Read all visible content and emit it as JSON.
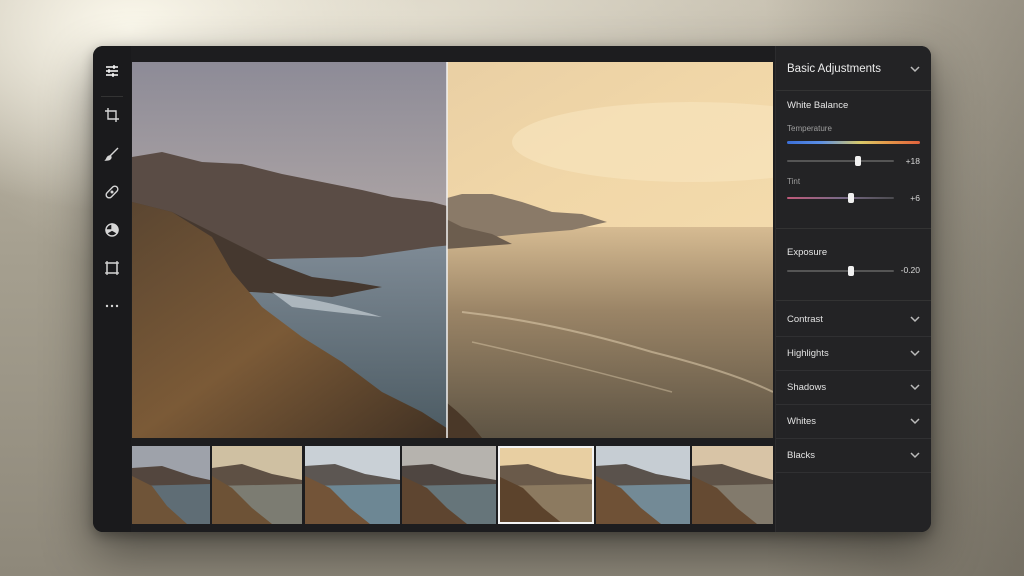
{
  "panel": {
    "title": "Basic Adjustments",
    "white_balance": {
      "title": "White Balance",
      "temperature": {
        "label": "Temperature",
        "value": "+18",
        "position": 0.66
      },
      "tint": {
        "label": "Tint",
        "value": "+6",
        "position": 0.6
      }
    },
    "exposure": {
      "title": "Exposure",
      "value": "-0.20",
      "position": 0.6
    },
    "rows": [
      {
        "label": "Contrast"
      },
      {
        "label": "Highlights"
      },
      {
        "label": "Shadows"
      },
      {
        "label": "Whites"
      },
      {
        "label": "Blacks"
      }
    ]
  },
  "toolbar": {
    "tools": [
      "sliders-icon",
      "crop-icon",
      "brush-icon",
      "healing-icon",
      "color-wheel-icon",
      "transform-grid-icon",
      "more-icon"
    ]
  },
  "filmstrip": {
    "count": 7,
    "selected_index": 4
  },
  "colors": {
    "accent": "#f0f0f0",
    "panel_bg": "#232325",
    "app_bg": "#1d1d1f"
  }
}
